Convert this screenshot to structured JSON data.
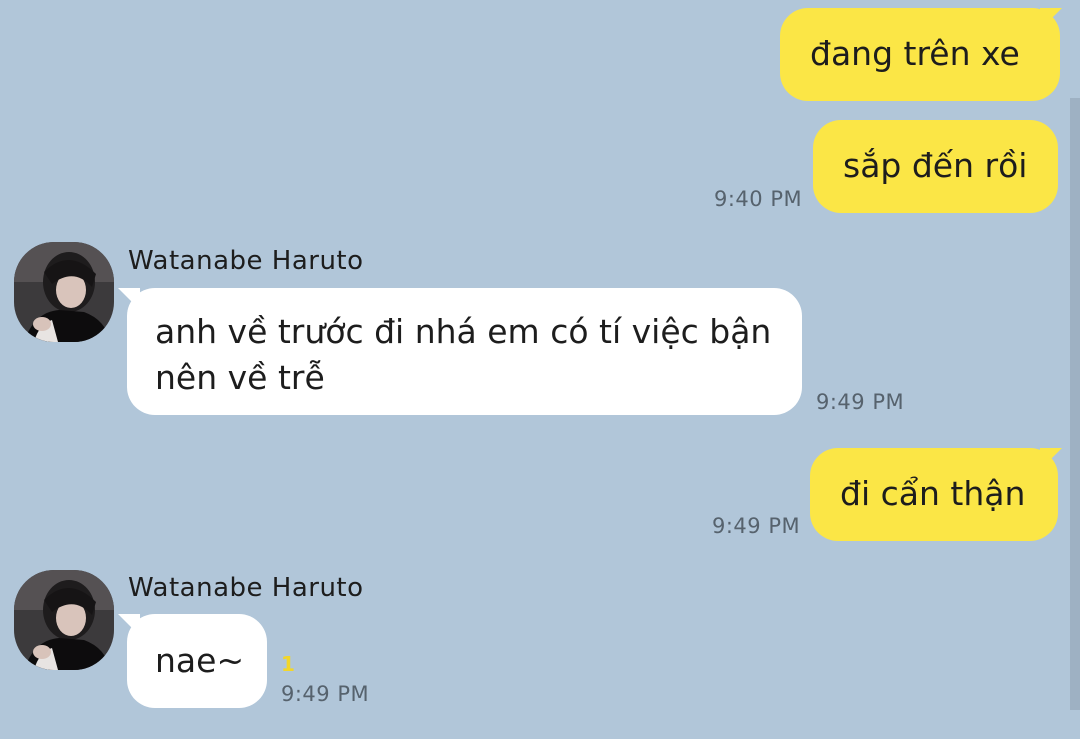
{
  "theme": {
    "background": "#b1c6d9",
    "outgoing_bubble": "#fbe646",
    "incoming_bubble": "#ffffff",
    "unread_color": "#f2d62a"
  },
  "messages": {
    "out1": {
      "text": "đang trên xe"
    },
    "out2": {
      "text": "sắp đến rồi",
      "time": "9:40 PM"
    },
    "in1": {
      "sender": "Watanabe Haruto",
      "avatar_icon": "profile-photo",
      "text": "anh về trước đi nhá em có tí việc bận nên về trễ",
      "time": "9:49 PM"
    },
    "out3": {
      "text": "đi cẩn thận",
      "time": "9:49 PM"
    },
    "in2": {
      "sender": "Watanabe Haruto",
      "avatar_icon": "profile-photo",
      "text": "nae~",
      "unread": "1",
      "time": "9:49 PM"
    }
  }
}
